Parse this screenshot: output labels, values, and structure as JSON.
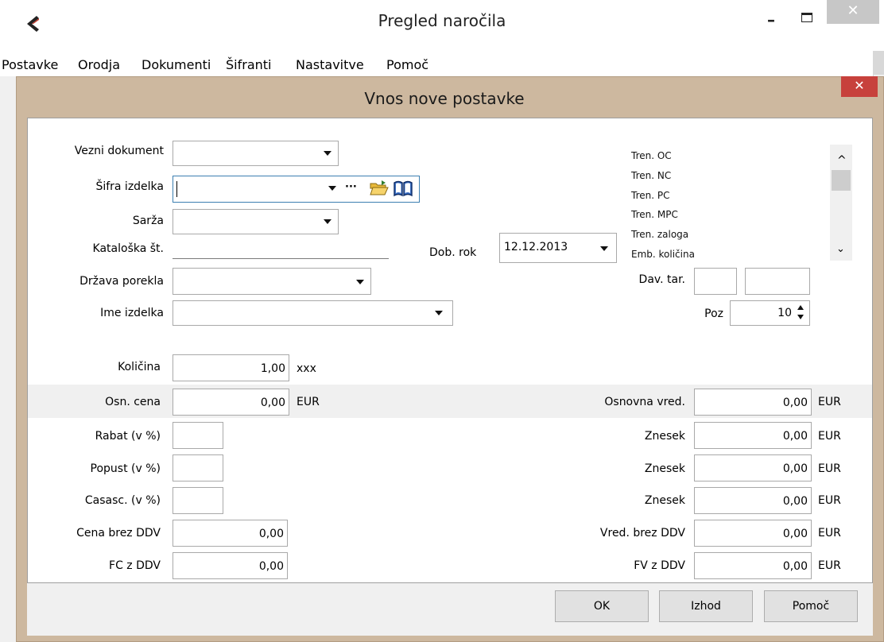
{
  "window": {
    "title": "Pregled naročila",
    "minimize_glyph": "–",
    "close_glyph": "✕"
  },
  "menu": [
    "Postavke",
    "Orodja",
    "Dokumenti",
    "Šifranti",
    "Nastavitve",
    "Pomoč"
  ],
  "dialog": {
    "title": "Vnos nove postavke",
    "close_glyph": "✕"
  },
  "form": {
    "vezni_dokument_label": "Vezni dokument",
    "sifra_izdelka_label": "Šifra izdelka",
    "sifra_izdelka_value": "",
    "ellipsis_glyph": "···",
    "sarza_label": "Sarža",
    "kataloska_label": "Kataloška št.",
    "dob_rok_label": "Dob. rok",
    "dob_rok_value": "12.12.2013",
    "drzava_label": "Država porekla",
    "dav_tar_label": "Dav. tar.",
    "ime_izdelka_label": "Ime izdelka",
    "poz_label": "Poz",
    "poz_value": "10",
    "kolicina_label": "Količina",
    "kolicina_value": "1,00",
    "kolicina_unit": "xxx",
    "osn_cena_label": "Osn. cena",
    "osn_cena_value": "0,00",
    "osn_cena_unit": "EUR",
    "rabat_label": "Rabat (v %)",
    "popust_label": "Popust (v %)",
    "casasc_label": "Casasc. (v %)",
    "cena_brez_label": "Cena brez DDV",
    "cena_brez_value": "0,00",
    "fc_label": "FC z DDV",
    "fc_value": "0,00"
  },
  "info_list": {
    "items": [
      "Tren. OC",
      "Tren. NC",
      "Tren. PC",
      "Tren. MPC",
      "Tren. zaloga",
      "Emb. količina"
    ]
  },
  "right_values": [
    {
      "label": "Osnovna vred.",
      "value": "0,00",
      "unit": "EUR"
    },
    {
      "label": "Znesek",
      "value": "0,00",
      "unit": "EUR"
    },
    {
      "label": "Znesek",
      "value": "0,00",
      "unit": "EUR"
    },
    {
      "label": "Znesek",
      "value": "0,00",
      "unit": "EUR"
    },
    {
      "label": "Vred. brez DDV",
      "value": "0,00",
      "unit": "EUR"
    },
    {
      "label": "FV z DDV",
      "value": "0,00",
      "unit": "EUR"
    }
  ],
  "buttons": {
    "ok": "OK",
    "izhod": "Izhod",
    "pomoc": "Pomoč"
  }
}
